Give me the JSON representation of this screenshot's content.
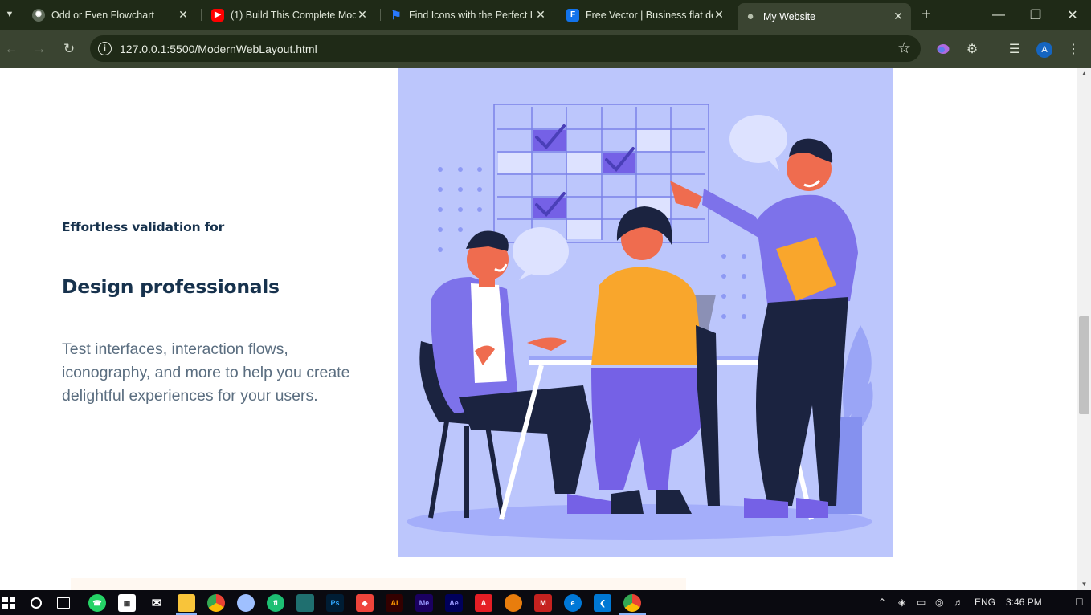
{
  "browser": {
    "tabs": [
      {
        "title": "Odd or Even Flowchart",
        "favicon": "chatgpt-icon",
        "color": "#5f6b5a"
      },
      {
        "title": "(1) Build This Complete Mod",
        "favicon": "youtube-icon",
        "color": "#ff0000"
      },
      {
        "title": "Find Icons with the Perfect L",
        "favicon": "flaticon-icon",
        "color": "#2979ff"
      },
      {
        "title": "Free Vector | Business flat de",
        "favicon": "freepik-icon",
        "color": "#1273eb"
      },
      {
        "title": "My Website",
        "favicon": "globe-icon",
        "color": "#9aa391",
        "active": true
      }
    ],
    "url": "127.0.0.1:5500/ModernWebLayout.html",
    "profile_initial": "A",
    "theme": {
      "frame": "#1f2a17",
      "toolbar": "#3a4431"
    }
  },
  "page": {
    "eyebrow": "Effortless validation for",
    "headline": "Design professionals",
    "body": "Test interfaces, interaction flows, iconography, and more to help you create delightful experiences for your users.",
    "hero_image": {
      "subject": "business team meeting illustration",
      "background": "#bcc6fc",
      "accent": "#6b56e0"
    },
    "text_color": "#17324d",
    "body_color": "#5b6e80"
  },
  "taskbar": {
    "apps": [
      "start-icon",
      "search-icon",
      "task-view-icon",
      "whatsapp-icon",
      "store-icon",
      "mail-icon",
      "file-explorer-icon",
      "chrome-icon",
      "paint-icon",
      "fiverr-icon",
      "app-icon",
      "photoshop-icon",
      "anydesk-icon",
      "illustrator-icon",
      "media-encoder-icon",
      "after-effects-icon",
      "acrobat-icon",
      "blender-icon",
      "gmail-icon",
      "edge-icon",
      "vscode-icon",
      "chrome-active-icon"
    ],
    "language": "ENG",
    "time": "3:46 PM"
  }
}
